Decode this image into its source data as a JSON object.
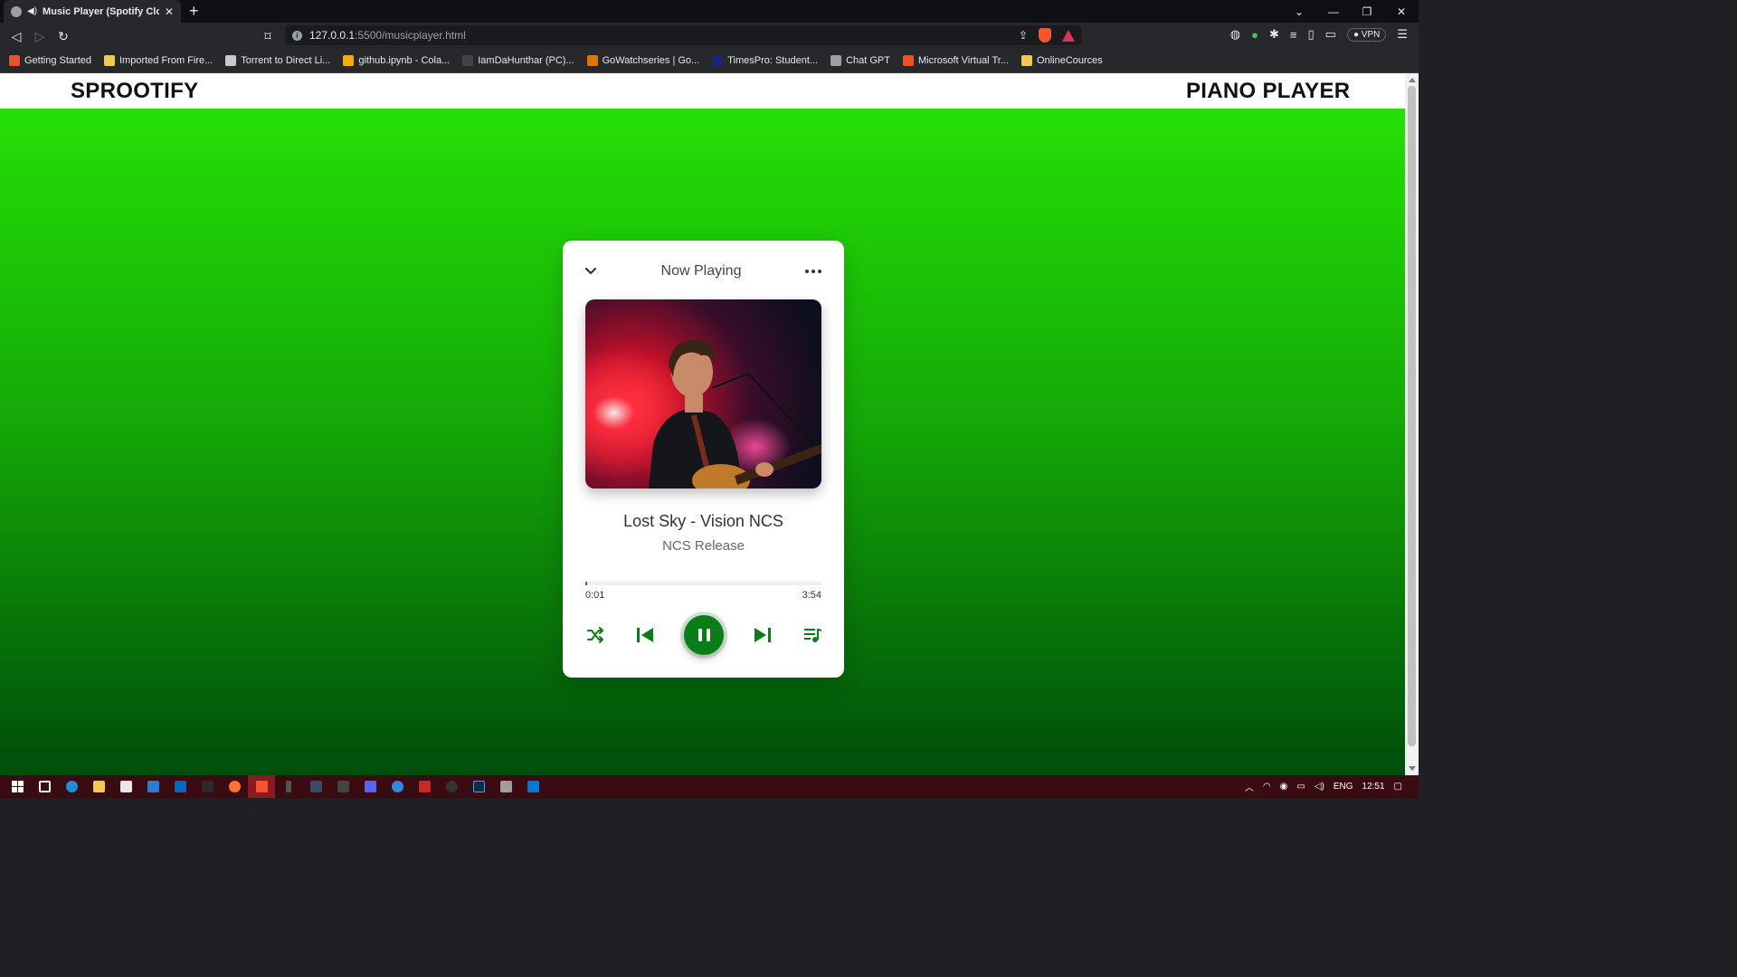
{
  "browser": {
    "tab_title": "Music Player (Spotify Clone)",
    "tab_close": "✕",
    "new_tab": "+",
    "url_host": "127.0.0.1",
    "url_path": ":5500/musicplayer.html",
    "vpn_label": "VPN",
    "bookmarks": [
      {
        "label": "Getting Started",
        "color": "#e8542c"
      },
      {
        "label": "Imported From Fire...",
        "color": "#f2c94c"
      },
      {
        "label": "Torrent to Direct Li...",
        "color": "#c9c9c9"
      },
      {
        "label": "github.ipynb - Cola...",
        "color": "#f9ab00"
      },
      {
        "label": "IamDaHunthar (PC)...",
        "color": "#444444"
      },
      {
        "label": "GoWatchseries | Go...",
        "color": "#e37400"
      },
      {
        "label": "TimesPro: Student...",
        "color": "#1a237e"
      },
      {
        "label": "Chat GPT",
        "color": "#9e9e9e"
      },
      {
        "label": "Microsoft Virtual Tr...",
        "color": "#f25022"
      },
      {
        "label": "OnlineCources",
        "color": "#f2c94c"
      }
    ]
  },
  "site": {
    "brand": "SPROOTIFY",
    "right_title": "PIANO PLAYER"
  },
  "player": {
    "header": "Now Playing",
    "song_title": "Lost Sky - Vision NCS",
    "artist": "NCS Release",
    "current_time": "0:01",
    "duration": "3:54",
    "progress": 0.004,
    "accent_color": "#0b7d18",
    "icons": [
      "chevron-down-icon",
      "more-dots-icon",
      "shuffle-icon",
      "previous-icon",
      "pause-icon",
      "next-icon",
      "playlist-icon"
    ]
  },
  "taskbar": {
    "language": "ENG",
    "clock": "12:51"
  }
}
